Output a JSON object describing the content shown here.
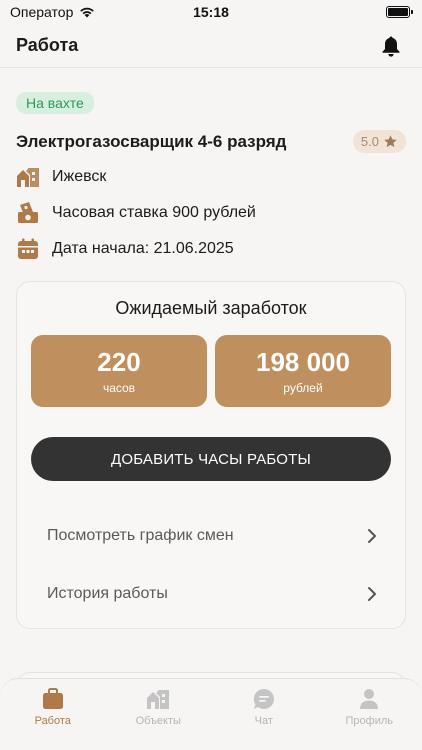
{
  "status_bar": {
    "carrier": "Оператор",
    "time": "15:18"
  },
  "header": {
    "title": "Работа"
  },
  "job": {
    "tag": "На вахте",
    "title": "Электрогазосварщик 4-6 разряд",
    "rating": "5.0",
    "city": "Ижевск",
    "rate": "Часовая ставка 900 рублей",
    "start_date": "Дата начала: 21.06.2025"
  },
  "earnings": {
    "title": "Ожидаемый заработок",
    "hours_value": "220",
    "hours_unit": "часов",
    "money_value": "198 000",
    "money_unit": "рублей",
    "add_button": "ДОБАВИТЬ ЧАСЫ РАБОТЫ",
    "links": [
      "Посмотреть график смен",
      "История работы"
    ]
  },
  "nav": [
    {
      "label": "Работа",
      "icon": "briefcase-icon",
      "active": true
    },
    {
      "label": "Объекты",
      "icon": "building-icon",
      "active": false
    },
    {
      "label": "Чат",
      "icon": "chat-icon",
      "active": false
    },
    {
      "label": "Профиль",
      "icon": "person-icon",
      "active": false
    }
  ],
  "colors": {
    "accent": "#bf8f5d",
    "tag_bg": "#d8efe0",
    "tag_text": "#2c9a56",
    "button": "#333333"
  }
}
